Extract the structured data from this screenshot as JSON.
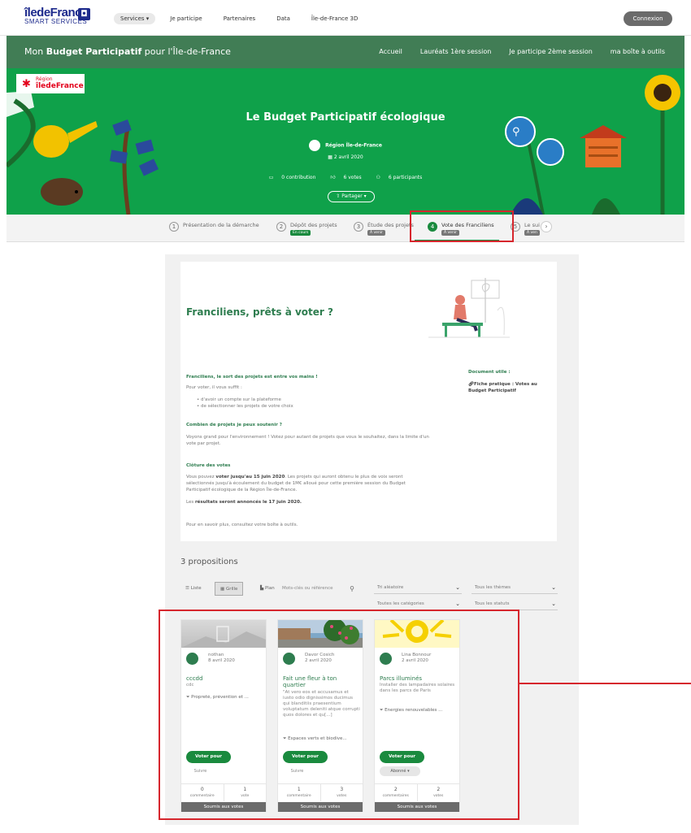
{
  "topbar": {
    "logo_main": "îledeFrance",
    "logo_sub": "SMART SERVICES",
    "nav": [
      "Services ▾",
      "Je participe",
      "Partenaires",
      "Data",
      "Île-de-France 3D"
    ],
    "login": "Connexion"
  },
  "bandeau": {
    "title_prefix": "Mon ",
    "title_bold": "Budget Participatif",
    "title_suffix": " pour l'Île-de-France",
    "menu": [
      "Accueil",
      "Lauréats 1ère session",
      "Je participe 2ème session",
      "ma boîte à outils"
    ]
  },
  "hero": {
    "region_top": "Région",
    "region_name": "îledeFrance",
    "title": "Le Budget Participatif écologique",
    "org": "Région Île-de-France",
    "date": "2 avril 2020",
    "stats": [
      "0 contribution",
      "6 votes",
      "6 participants"
    ],
    "share": "Partager ▾"
  },
  "steps": [
    {
      "num": "1",
      "label": "Présentation de la démarche",
      "badge": ""
    },
    {
      "num": "2",
      "label": "Dépôt des projets",
      "badge": "En cours"
    },
    {
      "num": "3",
      "label": "Étude des projets",
      "badge": "À venir"
    },
    {
      "num": "4",
      "label": "Vote des Franciliens",
      "badge": "À venir"
    },
    {
      "num": "5",
      "label": "Le sui",
      "badge": "À ven"
    }
  ],
  "intro": {
    "title": "Franciliens, prêts à voter ?",
    "h1": "Franciliens, le sort des projets est entre vos mains !",
    "p1": "Pour voter, il vous suffit :",
    "li1": "• d'avoir un compte sur la plateforme",
    "li2": "• de sélectionner les projets de votre choix",
    "h2": "Combien de projets je peux soutenir ?",
    "p2": "Voyons grand pour l'environnement ! Votez pour autant de projets que vous le souhaitez, dans la limite d'un vote par projet.",
    "h3": "Clôture des votes",
    "p3a": "Vous pouvez ",
    "p3b": "voter jusqu'au 15 juin 2020",
    "p3c": ". Les projets qui auront obtenu le plus de voix seront sélectionnés jusqu'à écoulement du budget de 1M€ alloué pour cette première session du Budget Participatif écologique de la Région Île-de-France.",
    "p4a": "Les ",
    "p4b": "résultats seront annoncés le 17 juin 2020.",
    "p5": "Pour en savoir plus, consultez votre boîte à outils.",
    "doc_title": "Document utile :",
    "doc_link": "Fiche pratique : Votes au Budget Participatif"
  },
  "props": {
    "count_label": "3 propositions",
    "views": [
      "Liste",
      "Grille",
      "Plan"
    ],
    "search_placeholder": "Mots-clés ou référence",
    "filters": [
      "Tri aléatoire",
      "Tous les thèmes",
      "Toutes les catégories",
      "Tous les statuts"
    ]
  },
  "cards": [
    {
      "author": "nothan",
      "date": "8 avril 2020",
      "title": "cccdd",
      "desc": "cdc",
      "tag": "Propreté, prévention et ...",
      "vote": "Voter pour",
      "follow": "Suivre",
      "comments": "0",
      "comments_label": "commentaire",
      "votes": "1",
      "votes_label": "vote",
      "status": "Soumis aux votes"
    },
    {
      "author": "Davor Cosich",
      "date": "2 avril 2020",
      "title": "Fait une fleur à ton quartier",
      "desc": "\"At vero eos et accusamus et iusto odio dignissimos ducimus qui blanditiis praesentium voluptatum deleniti atque corrupti quos dolores et qu[...]",
      "tag": "Espaces verts et biodive...",
      "vote": "Voter pour",
      "follow": "Suivre",
      "comments": "1",
      "comments_label": "commentaire",
      "votes": "3",
      "votes_label": "votes",
      "status": "Soumis aux votes"
    },
    {
      "author": "Lina Bonnour",
      "date": "2 avril 2020",
      "title": "Parcs illuminés",
      "desc": "Installer des lampadaires solaires dans les parcs de Paris",
      "tag": "Énergies renouvelables ...",
      "vote": "Voter pour",
      "follow": "Abonné ▾",
      "comments": "2",
      "comments_label": "commentaires",
      "votes": "2",
      "votes_label": "votes",
      "status": "Soumis aux votes"
    }
  ]
}
